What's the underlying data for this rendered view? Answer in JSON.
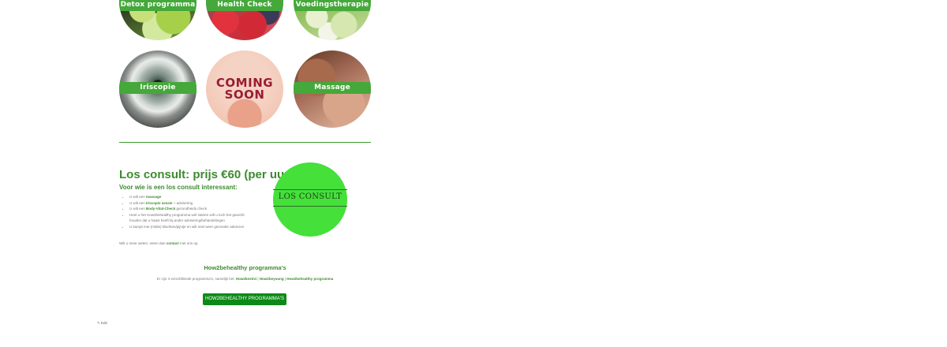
{
  "services": [
    {
      "label": "Detox programma"
    },
    {
      "label": "Health Check"
    },
    {
      "label": "Voedingstherapie"
    },
    {
      "label": "Iriscopie"
    },
    {
      "label": "COMING SOON"
    },
    {
      "label": "Massage"
    }
  ],
  "consult": {
    "heading": "Los consult: prijs €60 (per uur)",
    "subheading": "Voor wie is een los consult interessant:",
    "bullets": [
      {
        "pre": "U wilt een ",
        "bold": "massage",
        "post": ""
      },
      {
        "pre": "U wilt een ",
        "bold": "Iriscopie sessie",
        "post": " + advisering"
      },
      {
        "pre": "U wilt een ",
        "bold": "Body-Vital-Check",
        "post": " gezondheids check"
      },
      {
        "pre": "",
        "bold": "",
        "post": "Heet u het How2behealthy programma wel starten wilt u toch het gewicht houden dat u haast heeft bij ander advisering/behandelingen"
      },
      {
        "pre": "",
        "bold": "",
        "post": "U kampt met (milde) klachten/pijntje en wilt snel weer gezonder adviezen"
      }
    ],
    "more_pre": "Wilt u meer weten, neem dan ",
    "more_link": "contact",
    "more_post": " met ons op.",
    "circle_text": "LOS CONSULT"
  },
  "programmas": {
    "title": "How2behealthy programma's",
    "desc_pre": "Er zijn 3 verschillende programma's, namelijk het: ",
    "link1": "How2bestivi",
    "sep1": " | ",
    "link2": "How2beyoung",
    "sep2": " | ",
    "link3": "How2behealthy programma",
    "button": "HOW2BEHEALTHY PROGRAMMA'S"
  },
  "edit_label": "Edit",
  "colors": {
    "brand_green": "#3d8b2f",
    "band_green": "#45a83a",
    "button_green": "#0c8a17",
    "consult_circle": "#45e03a"
  }
}
